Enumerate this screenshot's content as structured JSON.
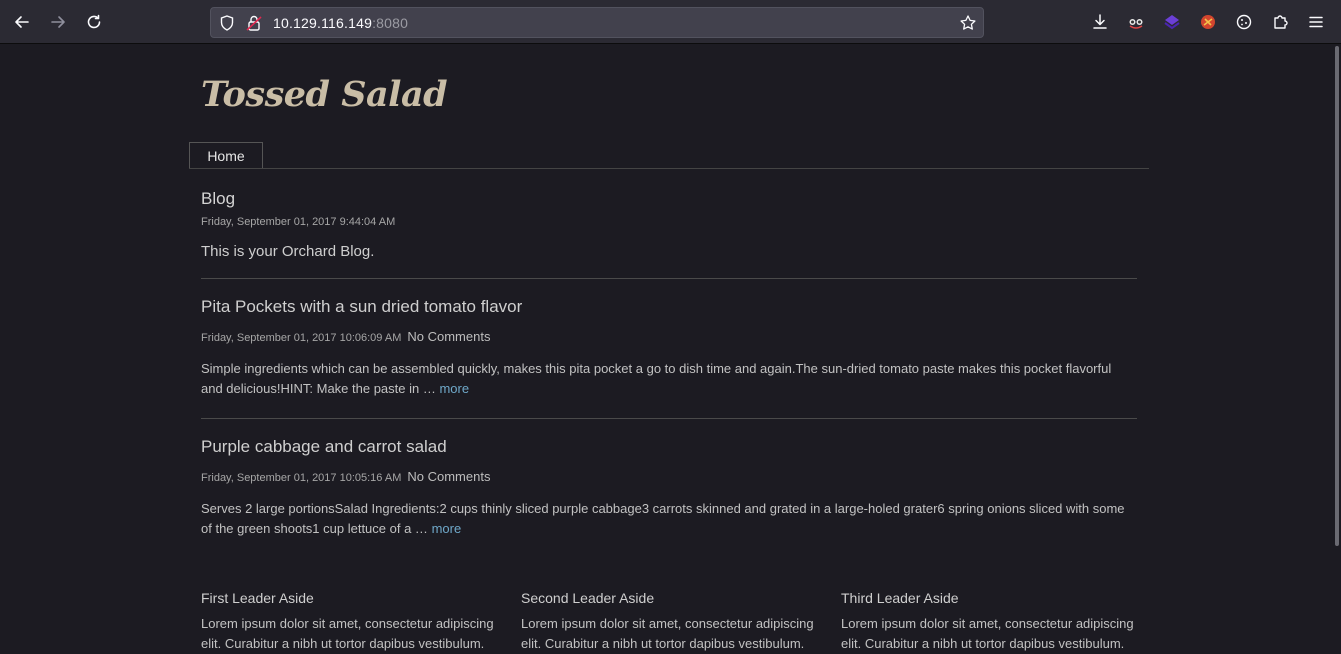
{
  "browser": {
    "url_host": "10.129.116.149",
    "url_port": ":8080",
    "icons": [
      "back-icon",
      "forward-icon",
      "reload-icon",
      "shield-icon",
      "lock-icon",
      "star-icon",
      "download-icon",
      "extension-icon",
      "extensions-puzzle-icon",
      "menu-icon"
    ]
  },
  "site": {
    "title": "Tossed Salad",
    "nav": {
      "home": "Home"
    }
  },
  "blog": {
    "title": "Blog",
    "date": "Friday, September 01, 2017 9:44:04 AM",
    "description": "This is your Orchard Blog."
  },
  "posts": [
    {
      "title": "Pita Pockets with a sun dried tomato flavor",
      "date": "Friday, September 01, 2017 10:06:09 AM",
      "comments": "No Comments",
      "excerpt": "Simple ingredients which can be assembled quickly, makes this pita pocket a go to dish time and again.The sun-dried tomato paste makes this pocket flavorful and delicious!HINT:  Make the paste in …",
      "more": "more"
    },
    {
      "title": "Purple cabbage and carrot salad",
      "date": "Friday, September 01, 2017 10:05:16 AM",
      "comments": "No Comments",
      "excerpt": "Serves 2 large portionsSalad Ingredients:2 cups thinly sliced purple cabbage3 carrots skinned and grated in a large-holed grater6 spring onions sliced with some of the green shoots1 cup lettuce of a …",
      "more": "more"
    }
  ],
  "asides": [
    {
      "title": "First Leader Aside",
      "text": "Lorem ipsum dolor sit amet, consectetur adipiscing elit. Curabitur a nibh ut tortor dapibus vestibulum."
    },
    {
      "title": "Second Leader Aside",
      "text": "Lorem ipsum dolor sit amet, consectetur adipiscing elit. Curabitur a nibh ut tortor dapibus vestibulum."
    },
    {
      "title": "Third Leader Aside",
      "text": "Lorem ipsum dolor sit amet, consectetur adipiscing elit. Curabitur a nibh ut tortor dapibus vestibulum."
    }
  ],
  "colors": {
    "page_bg": "#1c1b22",
    "toolbar_bg": "#2b2a33",
    "title_color": "#c9bda6",
    "link_color": "#6fa8c9"
  }
}
